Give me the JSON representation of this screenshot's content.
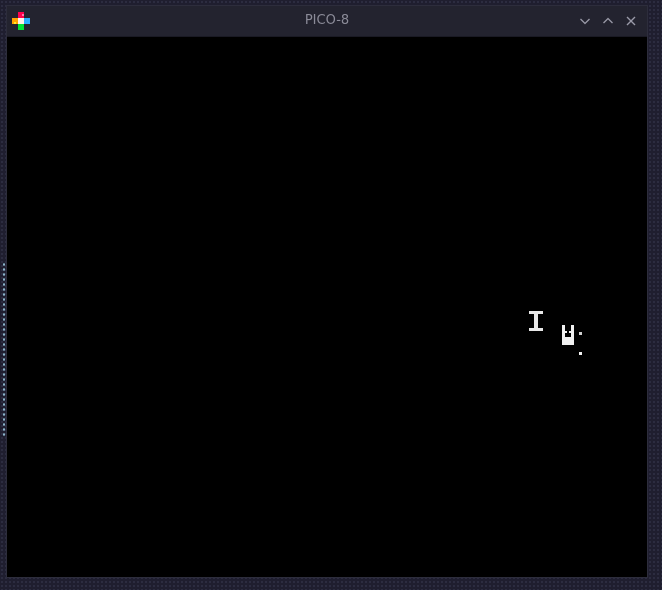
{
  "window": {
    "title": "PICO-8",
    "app_icon": "pico8-logo-icon",
    "controls": {
      "minimize_icon": "chevron-down-icon",
      "maximize_icon": "chevron-up-icon",
      "close_icon": "close-icon"
    }
  },
  "game": {
    "background_color": "#000000",
    "sprites": [
      {
        "name": "i-beam-cursor-sprite"
      },
      {
        "name": "player-sprite"
      }
    ]
  },
  "colors": {
    "titlebar": "#23232f",
    "title_text": "#8b8b98",
    "desktop": "#1f1e2f"
  }
}
